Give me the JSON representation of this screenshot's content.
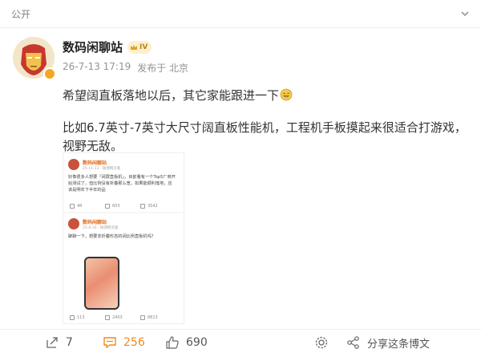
{
  "post": {
    "visibility": "公开",
    "author": "数码闲聊站",
    "vip_level": "IV",
    "timestamp": "26-7-13 17:19",
    "source": "发布于 北京",
    "text_line1": "希望阔直板落地以后，其它家能跟进一下",
    "text_body": "比如6.7英寸-7英寸大尺寸阔直板性能机，工程机手板摸起来很适合打游戏，视野无敌。",
    "emoji": "smiling-sweat-emoji"
  },
  "embedded": {
    "post1": {
      "author": "数码闲聊站",
      "meta": "25-11-13 · 微博网页版",
      "text": "好像很多人想要「阔屏直板机」，目前看有一个Top5厂商开始测试了，但比例没有折叠那么宽，如果能顺利落地，应该是明年下半年的品",
      "reposts": "48",
      "comments": "603",
      "likes": "3542"
    },
    "post2": {
      "author": "数码闲聊站",
      "meta": "25-8-16 · 微博网页版",
      "text": "聊聊一下，想要非折叠形态的阔比例直板机吗？",
      "reposts": "113",
      "comments": "2403",
      "likes": "8813"
    }
  },
  "actions": {
    "repost_count": "7",
    "comment_count": "256",
    "like_count": "690",
    "block_label": "",
    "share_label": "分享这条博文"
  },
  "colors": {
    "accent": "#f08a1c",
    "author": "#222222",
    "meta": "#939393",
    "embed_name": "#e06b1f"
  }
}
